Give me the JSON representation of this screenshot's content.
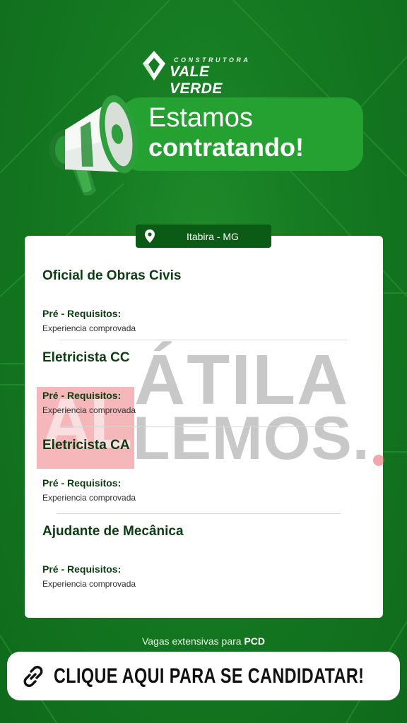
{
  "brand": {
    "small_text": "CONSTRUTORA",
    "name": "VALE VERDE"
  },
  "hero": {
    "line1": "Estamos",
    "line2": "contratando!",
    "icon": "megaphone-icon"
  },
  "location": {
    "icon": "map-pin-icon",
    "text": "Itabira - MG"
  },
  "jobs": [
    {
      "title": "Oficial de Obras Civis",
      "req_label": "Pré - Requisitos:",
      "req_value": "Experiencia comprovada"
    },
    {
      "title": "Eletricista CC",
      "req_label": "Pré - Requisitos:",
      "req_value": "Experiencia comprovada"
    },
    {
      "title": "Eletricista CA",
      "req_label": "Pré - Requisitos:",
      "req_value": "Experiencia comprovada"
    },
    {
      "title": "Ajudante de Mecânica",
      "req_label": "Pré - Requisitos:",
      "req_value": "Experiencia comprovada"
    }
  ],
  "watermark": {
    "initials": "AL",
    "line1": "ÁTILA",
    "line2": "LEMOS."
  },
  "footer": {
    "note_prefix": "Vagas extensivas para",
    "note_bold": "PCD",
    "cta_icon": "link-icon",
    "cta_label": "CLIQUE AQUI PARA SE CANDIDATAR!"
  },
  "colors": {
    "background": "#157a22",
    "accent": "#25a131",
    "dark_green": "#0b5a16",
    "title_text": "#0c3d12"
  }
}
